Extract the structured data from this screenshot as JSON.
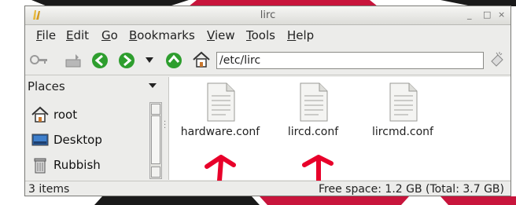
{
  "window": {
    "title": "lirc",
    "minimize": "_",
    "maximize": "□",
    "close": "×"
  },
  "menu": [
    {
      "label": "File",
      "key": "F",
      "rest": "ile"
    },
    {
      "label": "Edit",
      "key": "E",
      "rest": "dit"
    },
    {
      "label": "Go",
      "key": "G",
      "rest": "o"
    },
    {
      "label": "Bookmarks",
      "key": "B",
      "rest": "ookmarks"
    },
    {
      "label": "View",
      "key": "V",
      "rest": "iew"
    },
    {
      "label": "Tools",
      "key": "T",
      "rest": "ools"
    },
    {
      "label": "Help",
      "key": "H",
      "rest": "elp"
    }
  ],
  "toolbar": {
    "path": "/etc/lirc"
  },
  "places": {
    "header": "Places",
    "items": [
      {
        "label": "root",
        "icon": "home-icon"
      },
      {
        "label": "Desktop",
        "icon": "desktop-icon"
      },
      {
        "label": "Rubbish",
        "icon": "trash-icon"
      }
    ]
  },
  "files": [
    {
      "name": "hardware.conf"
    },
    {
      "name": "lircd.conf"
    },
    {
      "name": "lircmd.conf"
    }
  ],
  "status": {
    "items": "3 items",
    "free": "Free space: 1.2 GB (Total: 3.7 GB)"
  },
  "colors": {
    "annotation_arrow": "#e8002a",
    "go_green": "#2e9e2e"
  }
}
